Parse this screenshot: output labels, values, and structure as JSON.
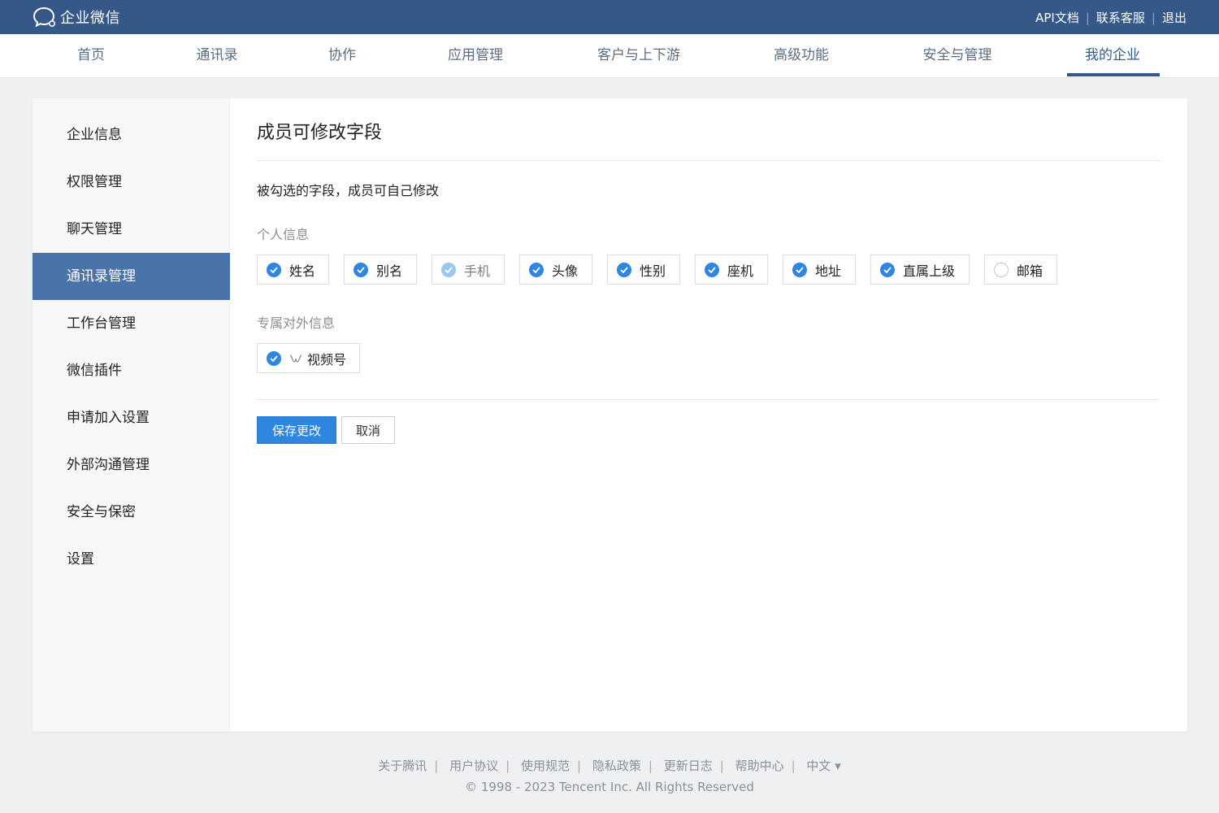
{
  "header": {
    "brand": "企业微信",
    "links": [
      "API文档",
      "联系客服",
      "退出"
    ]
  },
  "nav": {
    "items": [
      "首页",
      "通讯录",
      "协作",
      "应用管理",
      "客户与上下游",
      "高级功能",
      "安全与管理",
      "我的企业"
    ],
    "active": "我的企业"
  },
  "sidebar": {
    "items": [
      "企业信息",
      "权限管理",
      "聊天管理",
      "通讯录管理",
      "工作台管理",
      "微信插件",
      "申请加入设置",
      "外部沟通管理",
      "安全与保密",
      "设置"
    ],
    "active": "通讯录管理"
  },
  "main": {
    "title": "成员可修改字段",
    "description": "被勾选的字段，成员可自己修改",
    "personal_label": "个人信息",
    "personal_fields": [
      {
        "label": "姓名",
        "state": "checked"
      },
      {
        "label": "别名",
        "state": "checked"
      },
      {
        "label": "手机",
        "state": "checked-disabled"
      },
      {
        "label": "头像",
        "state": "checked"
      },
      {
        "label": "性别",
        "state": "checked"
      },
      {
        "label": "座机",
        "state": "checked"
      },
      {
        "label": "地址",
        "state": "checked"
      },
      {
        "label": "直属上级",
        "state": "checked"
      },
      {
        "label": "邮箱",
        "state": "unchecked"
      }
    ],
    "external_label": "专属对外信息",
    "external_fields": [
      {
        "label": "视频号",
        "state": "checked",
        "icon": "channels-icon"
      }
    ],
    "save_label": "保存更改",
    "cancel_label": "取消"
  },
  "footer": {
    "links": [
      "关于腾讯",
      "用户协议",
      "使用规范",
      "隐私政策",
      "更新日志",
      "帮助中心"
    ],
    "language": "中文 ▾",
    "copyright": "© 1998 - 2023 Tencent Inc. All Rights Reserved"
  },
  "colors": {
    "header_bg": "#355888",
    "accent": "#2e86de",
    "sidebar_active": "#4a74a9"
  }
}
